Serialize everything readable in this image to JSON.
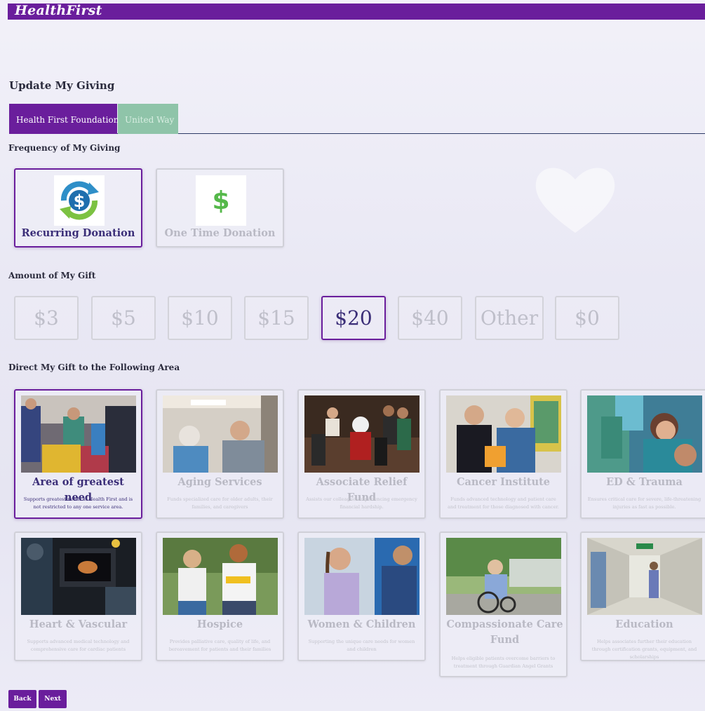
{
  "header": {
    "logo": "HealthFirst"
  },
  "page": {
    "title": "Update My Giving"
  },
  "tabs": [
    {
      "label": "Health First Foundation",
      "active": true
    },
    {
      "label": "United Way",
      "active": false
    }
  ],
  "frequency": {
    "label": "Frequency of My Giving",
    "options": [
      {
        "label": "Recurring Donation",
        "selected": true,
        "icon": "recurring-dollar-icon"
      },
      {
        "label": "One Time Donation",
        "selected": false,
        "icon": "dollar-icon"
      }
    ]
  },
  "amount": {
    "label": "Amount of My Gift",
    "options": [
      "$3",
      "$5",
      "$10",
      "$15",
      "$20",
      "$40",
      "Other",
      "$0"
    ],
    "selected": "$20"
  },
  "areas": {
    "label": "Direct My Gift to the Following Area",
    "items": [
      {
        "title": "Area of greatest need",
        "desc": "Supports greatest needs at Health First and is not restricted to any one service area.",
        "selected": true
      },
      {
        "title": "Aging Services",
        "desc": "Funds specialized care for older adults, their families, and caregivers",
        "selected": false
      },
      {
        "title": "Associate Relief Fund",
        "desc": "Assists our colleagues experiencing emergency financial hardship.",
        "selected": false
      },
      {
        "title": "Cancer Institute",
        "desc": "Funds advanced technology and patient care and treatment for those diagnosed with cancer.",
        "selected": false
      },
      {
        "title": "ED & Trauma",
        "desc": "Ensures critical care for severe, life-threatening injuries as fast as possible.",
        "selected": false
      },
      {
        "title": "Heart & Vascular",
        "desc": "Supports advanced medical technology and comprehensive care for cardiac patients",
        "selected": false
      },
      {
        "title": "Hospice",
        "desc": "Provides palliative care, quality of life, and bereavement for patients and their families",
        "selected": false
      },
      {
        "title": "Women & Children",
        "desc": "Supporting the unique care needs for women and children",
        "selected": false
      },
      {
        "title": "Compassionate Care Fund",
        "desc": "Helps eligible patients overcome barriers to treatment through Guardian Angel Grants",
        "selected": false
      },
      {
        "title": "Education",
        "desc": "Helps associates further their education through certification grants, equipment, and scholarships",
        "selected": false
      }
    ]
  },
  "nav": {
    "back": "Back",
    "next": "Next"
  },
  "colors": {
    "brand": "#6a1e9c",
    "tab_inactive": "#8fc4a9",
    "selected_text": "#3b2e78"
  }
}
